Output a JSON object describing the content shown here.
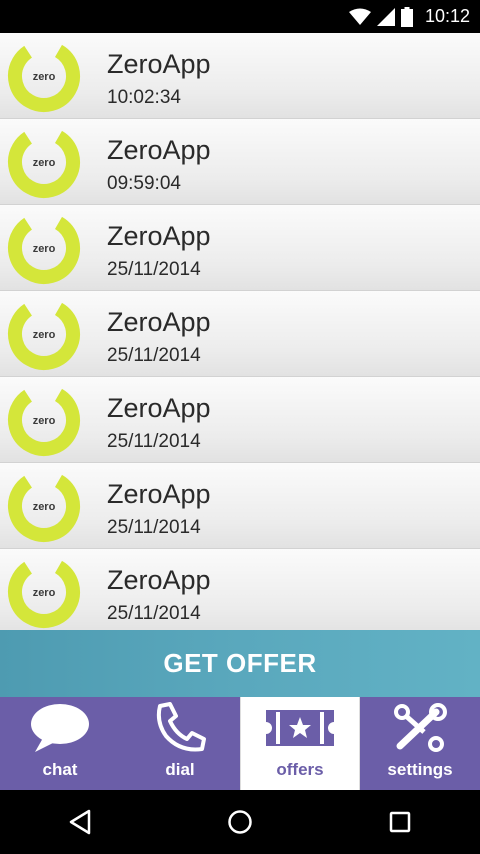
{
  "status_bar": {
    "time": "10:12"
  },
  "messages": [
    {
      "title": "ZeroApp",
      "time": "10:02:34",
      "logo_text": "zero"
    },
    {
      "title": "ZeroApp",
      "time": "09:59:04",
      "logo_text": "zero"
    },
    {
      "title": "ZeroApp",
      "time": "25/11/2014",
      "logo_text": "zero"
    },
    {
      "title": "ZeroApp",
      "time": "25/11/2014",
      "logo_text": "zero"
    },
    {
      "title": "ZeroApp",
      "time": "25/11/2014",
      "logo_text": "zero"
    },
    {
      "title": "ZeroApp",
      "time": "25/11/2014",
      "logo_text": "zero"
    },
    {
      "title": "ZeroApp",
      "time": "25/11/2014",
      "logo_text": "zero"
    }
  ],
  "get_offer": {
    "label": "GET OFFER"
  },
  "tabs": [
    {
      "label": "chat",
      "icon": "chat-bubble-icon",
      "active": false
    },
    {
      "label": "dial",
      "icon": "phone-icon",
      "active": false
    },
    {
      "label": "offers",
      "icon": "ticket-icon",
      "active": true
    },
    {
      "label": "settings",
      "icon": "wrench-icon",
      "active": false
    }
  ],
  "colors": {
    "brand_purple": "#6b5ea8",
    "offer_teal": "#5aa8bd",
    "logo_lime": "#d4e63a"
  }
}
